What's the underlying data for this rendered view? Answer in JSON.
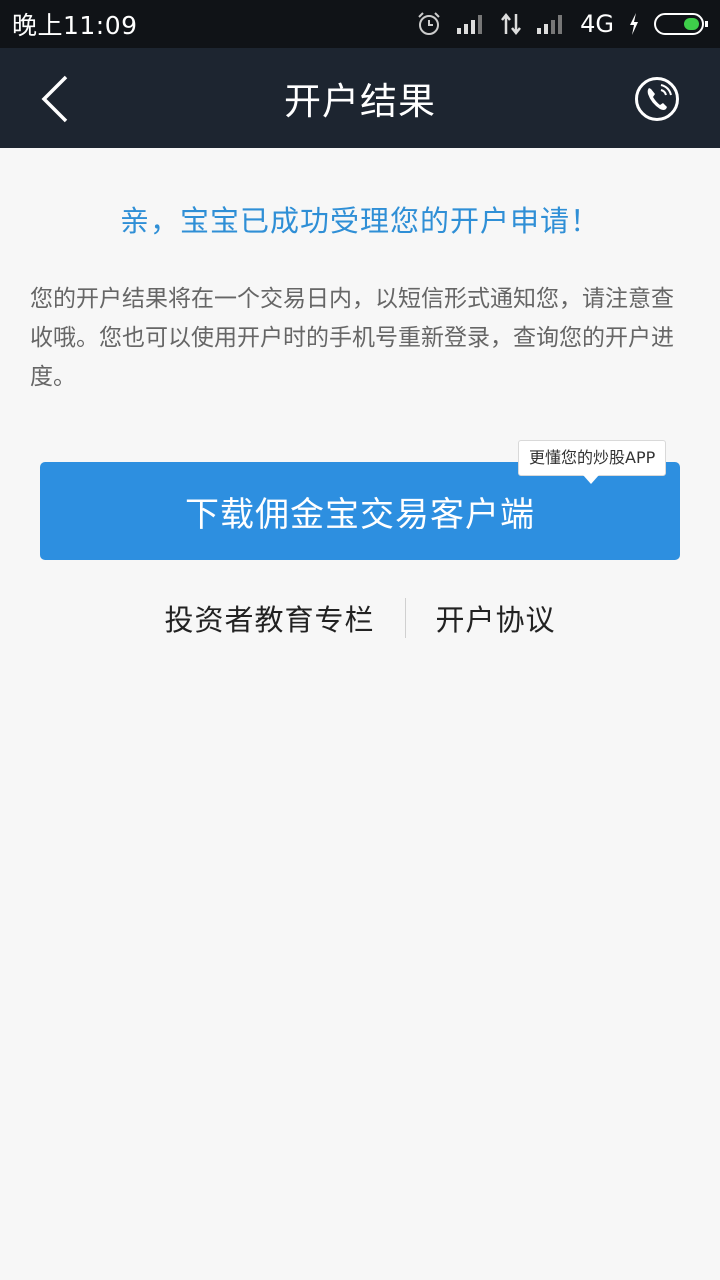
{
  "status_bar": {
    "time": "晚上11:09",
    "network": "4G",
    "icons": [
      "alarm-icon",
      "signal-icon",
      "data-arrows-icon",
      "signal-icon",
      "charging-icon",
      "battery-icon"
    ]
  },
  "nav": {
    "title": "开户结果",
    "back_icon": "chevron-left-icon",
    "phone_icon": "phone-icon"
  },
  "main": {
    "success_title": "亲，宝宝已成功受理您的开户申请！",
    "description": "您的开户结果将在一个交易日内，以短信形式通知您，请注意查收哦。您也可以使用开户时的手机号重新登录，查询您的开户进度。",
    "download_button": "下载佣金宝交易客户端",
    "tooltip": "更懂您的炒股APP",
    "links": [
      "投资者教育专栏",
      "开户协议"
    ]
  },
  "colors": {
    "accent": "#2d8fe0",
    "title_blue": "#2f8fd6",
    "nav_bg": "#1d2530",
    "status_bg": "#101317",
    "page_bg": "#f7f7f7"
  }
}
